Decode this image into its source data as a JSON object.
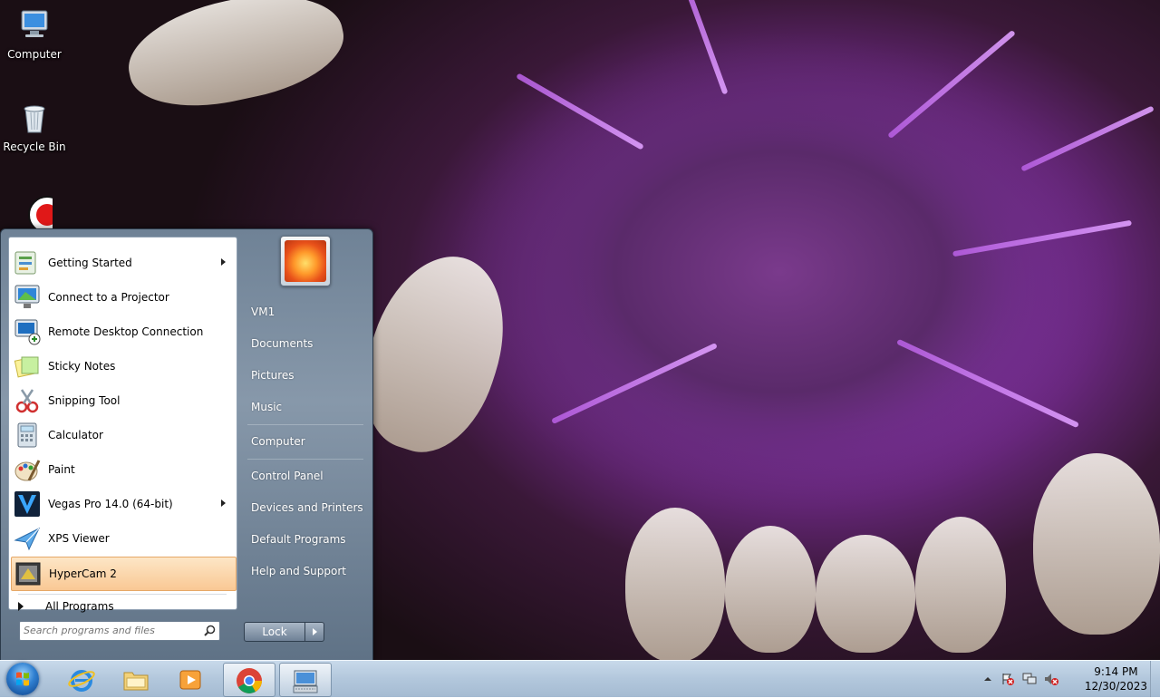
{
  "desktop": {
    "icons": [
      {
        "label": "Computer",
        "icon": "computer-icon"
      },
      {
        "label": "Recycle Bin",
        "icon": "recycle-bin-icon"
      },
      {
        "label": "",
        "icon": "record-icon"
      }
    ]
  },
  "start_menu": {
    "programs": [
      {
        "label": "Getting Started",
        "icon": "getting-started-icon",
        "submenu": true
      },
      {
        "label": "Connect to a Projector",
        "icon": "projector-icon",
        "submenu": false
      },
      {
        "label": "Remote Desktop Connection",
        "icon": "remote-desktop-icon",
        "submenu": false
      },
      {
        "label": "Sticky Notes",
        "icon": "sticky-notes-icon",
        "submenu": false
      },
      {
        "label": "Snipping Tool",
        "icon": "snipping-tool-icon",
        "submenu": false
      },
      {
        "label": "Calculator",
        "icon": "calculator-icon",
        "submenu": false
      },
      {
        "label": "Paint",
        "icon": "paint-icon",
        "submenu": false
      },
      {
        "label": "Vegas Pro 14.0 (64-bit)",
        "icon": "vegas-pro-icon",
        "submenu": true
      },
      {
        "label": "XPS Viewer",
        "icon": "xps-viewer-icon",
        "submenu": false
      },
      {
        "label": "HyperCam 2",
        "icon": "hypercam-icon",
        "submenu": false,
        "highlighted": true
      }
    ],
    "all_programs": "All Programs",
    "search_placeholder": "Search programs and files",
    "right": {
      "user": "VM1",
      "documents": "Documents",
      "pictures": "Pictures",
      "music": "Music",
      "computer": "Computer",
      "control_panel": "Control Panel",
      "devices_printers": "Devices and Printers",
      "default_programs": "Default Programs",
      "help_support": "Help and Support"
    },
    "lock_label": "Lock"
  },
  "taskbar": {
    "pinned": [
      {
        "name": "internet-explorer",
        "icon": "internet-explorer-icon"
      },
      {
        "name": "file-explorer",
        "icon": "folder-icon"
      },
      {
        "name": "media-player",
        "icon": "media-player-icon"
      },
      {
        "name": "chrome",
        "icon": "chrome-icon",
        "active": true
      },
      {
        "name": "on-screen-keyboard",
        "icon": "keyboard-icon",
        "active": true
      }
    ],
    "clock_time": "9:14 PM",
    "clock_date": "12/30/2023"
  },
  "colors": {
    "highlight": "#f9c894",
    "taskbar": "#b2c7dc",
    "menu_right": "#7a8ca0"
  }
}
